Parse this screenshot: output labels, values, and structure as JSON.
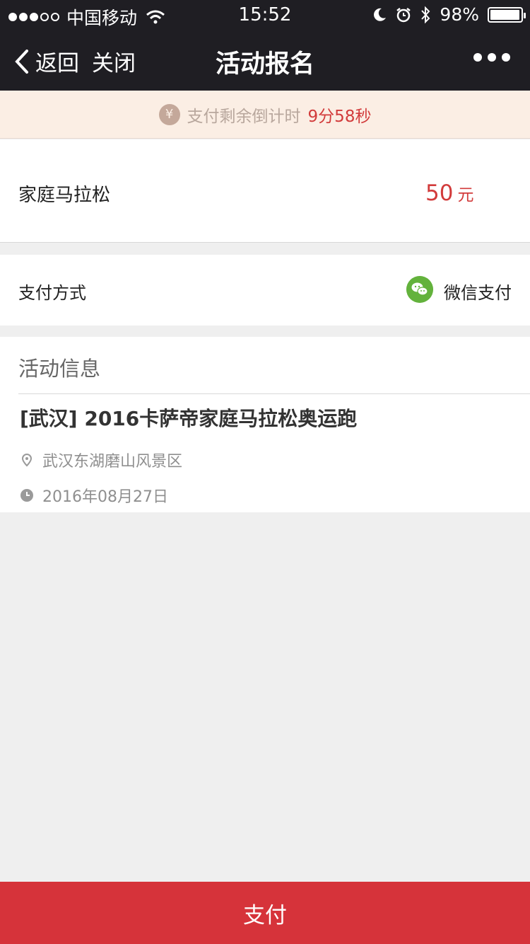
{
  "status_bar": {
    "carrier": "中国移动",
    "time": "15:52",
    "battery": "98%",
    "battery_level": 0.98
  },
  "nav": {
    "back_label": "返回",
    "close_label": "关闭",
    "title": "活动报名"
  },
  "countdown": {
    "label": "支付剩余倒计时",
    "time_left": "9分58秒",
    "icon": "¥"
  },
  "item": {
    "name": "家庭马拉松",
    "price": "50",
    "unit": "元"
  },
  "payment": {
    "label": "支付方式",
    "method": "微信支付"
  },
  "event_info": {
    "header": "活动信息",
    "title": "[武汉] 2016卡萨帝家庭马拉松奥运跑",
    "location": "武汉东湖磨山风景区",
    "date": "2016年08月27日"
  },
  "action": {
    "pay_label": "支付"
  },
  "colors": {
    "accent": "#d6333a",
    "nav_bg": "#1f1e23",
    "wechat_green": "#63b23c"
  }
}
